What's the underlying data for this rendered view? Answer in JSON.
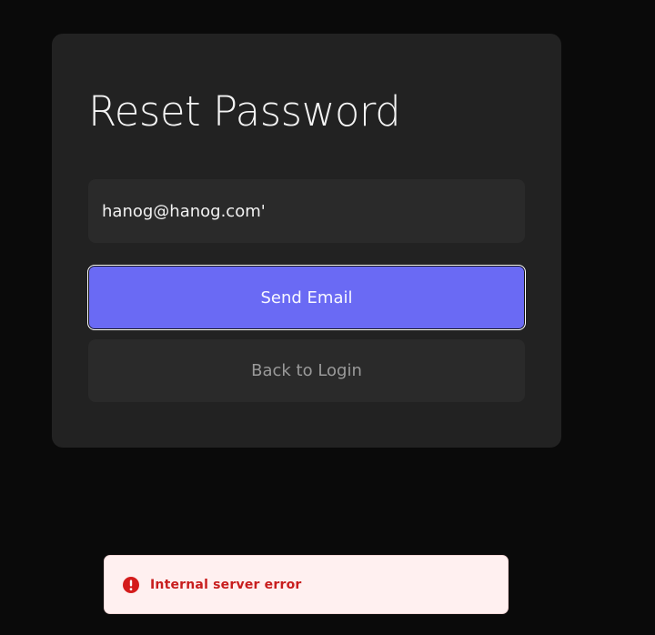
{
  "reset_form": {
    "title": "Reset Password",
    "email_value": "hanog@hanog.com'",
    "send_label": "Send Email",
    "back_label": "Back to Login"
  },
  "toast": {
    "icon": "error-circle-icon",
    "message": "Internal server error"
  },
  "colors": {
    "background": "#0a0a0a",
    "card": "#222222",
    "input": "#2a2a2a",
    "accent": "#6a6af4",
    "error_bg": "#fff0f0",
    "error_text": "#c81e1e"
  }
}
